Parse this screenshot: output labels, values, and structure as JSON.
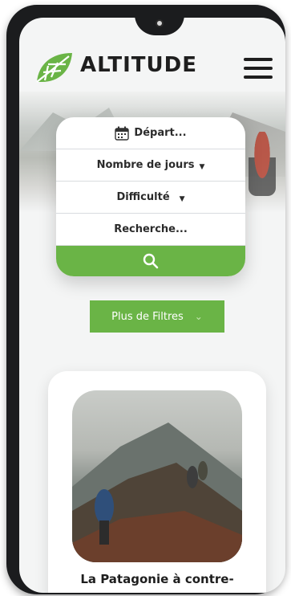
{
  "header": {
    "brand": "ALTITUDE"
  },
  "search": {
    "depart": "Départ...",
    "days": "Nombre de jours",
    "difficulty": "Difficulté",
    "query": "Recherche..."
  },
  "filters": {
    "label": "Plus de Filtres"
  },
  "trip": {
    "title": "La Patagonie à contre-"
  },
  "colors": {
    "accent": "#6ab446",
    "text": "#1e1e1e"
  }
}
